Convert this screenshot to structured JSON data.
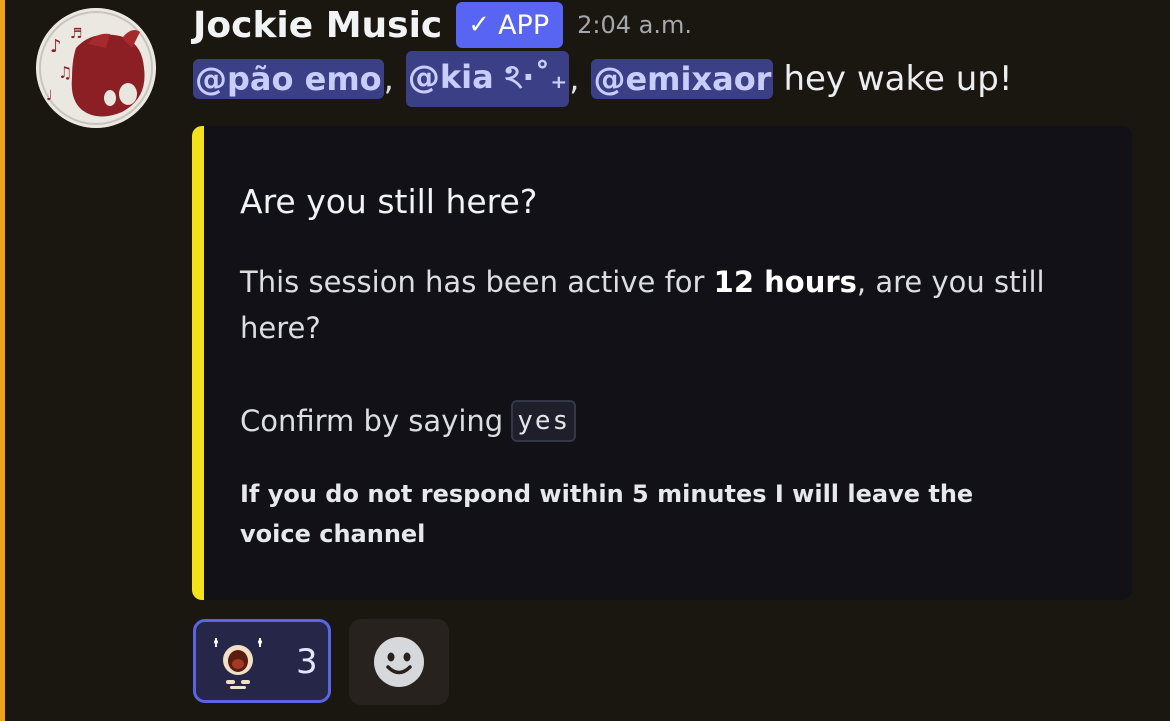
{
  "message": {
    "author": "Jockie Music",
    "badge": {
      "check": "✓",
      "label": "APP"
    },
    "timestamp": "2:04 a.m.",
    "mentions": [
      "@pão emo",
      "@kia ঽ·˚₊",
      "@emixaor"
    ],
    "separator": ",",
    "text": "hey wake up!"
  },
  "embed": {
    "accent_color": "#f1e21a",
    "title": "Are you still here?",
    "description_prefix": "This session has been active for ",
    "description_bold": "12 hours",
    "description_suffix": ", are you still here?",
    "confirm_prefix": "Confirm by saying",
    "confirm_code": "yes",
    "footer": "If you do not respond within 5 minutes I will leave the voice channel"
  },
  "reactions": [
    {
      "emoji": "shocked-face-emoji",
      "count": "3",
      "active": true
    }
  ],
  "add_reaction": {
    "icon": "smiley-icon"
  },
  "colors": {
    "mention_bg": "#3b3f86",
    "mention_text": "#c9cdfb",
    "badge_bg": "#5865f2",
    "left_strip": "#f0a21c",
    "embed_bg": "#111117"
  }
}
